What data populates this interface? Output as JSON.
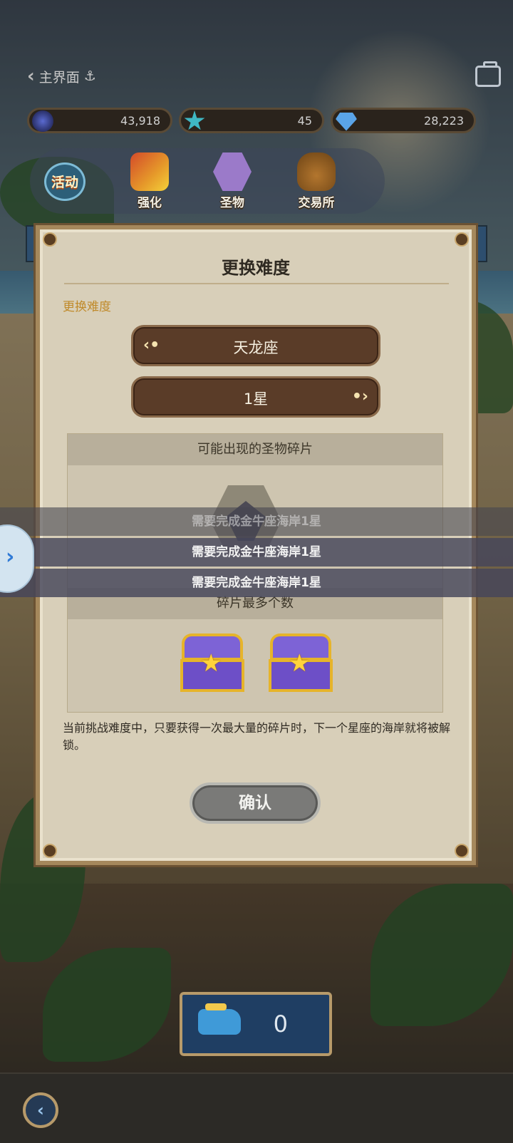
{
  "header": {
    "back_label": "主界面"
  },
  "resources": [
    {
      "icon": "black-orb-icon",
      "value": "43,918"
    },
    {
      "icon": "star-icon",
      "value": "45"
    },
    {
      "icon": "diamond-icon",
      "value": "28,223"
    }
  ],
  "nav": {
    "activity_label": "活动",
    "items": [
      {
        "icon": "shovel-upgrade-icon",
        "label": "强化"
      },
      {
        "icon": "relic-icon",
        "label": "圣物"
      },
      {
        "icon": "money-bag-icon",
        "label": "交易所"
      }
    ]
  },
  "dialog": {
    "title": "更换难度",
    "sublabel": "更换难度",
    "constellation": "天龙座",
    "stars": "1星",
    "fragments_header": "可能出现的圣物碎片",
    "max_header": "碎片最多个数",
    "description": "当前挑战难度中，只要获得一次最大量的碎片时，下一个星座的海岸就将被解锁。",
    "confirm_label": "确认"
  },
  "tips": [
    "需要完成金牛座海岸1星",
    "需要完成金牛座海岸1星",
    "需要完成金牛座海岸1星"
  ],
  "ammo": {
    "value": "0"
  }
}
